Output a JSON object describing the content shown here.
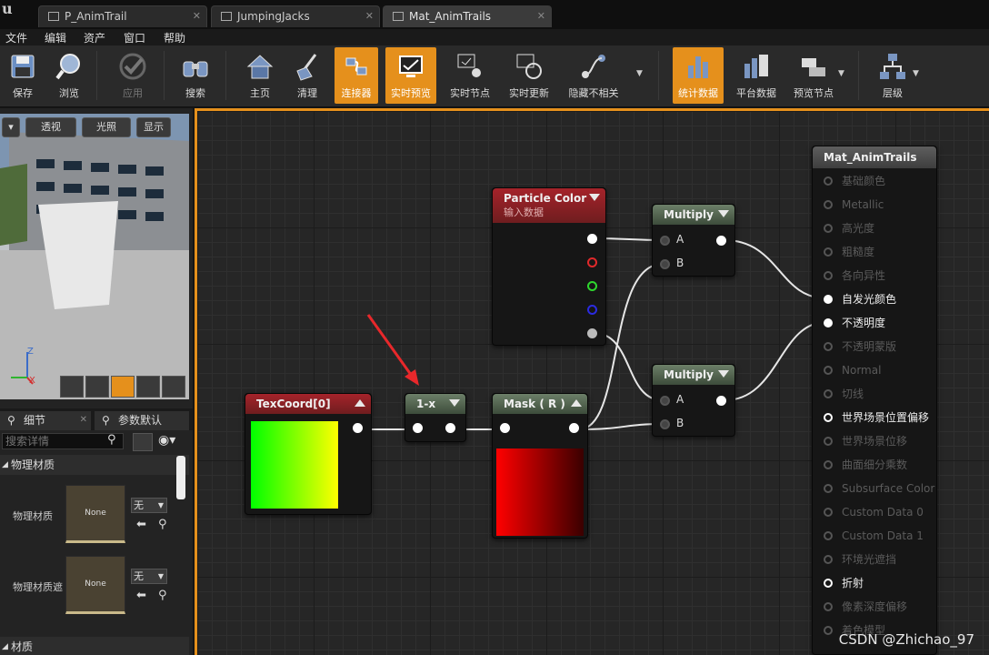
{
  "tabs": [
    {
      "label": "P_AnimTrail",
      "active": false
    },
    {
      "label": "JumpingJacks",
      "active": false
    },
    {
      "label": "Mat_AnimTrails",
      "active": true
    }
  ],
  "menu": [
    "文件",
    "编辑",
    "资产",
    "窗口",
    "帮助"
  ],
  "toolbar": {
    "save": "保存",
    "browse": "浏览",
    "apply": "应用",
    "search": "搜索",
    "home": "主页",
    "clean": "清理",
    "connector": "连接器",
    "live_preview": "实时预览",
    "live_nodes": "实时节点",
    "live_update": "实时更新",
    "hide_unrelated": "隐藏不相关",
    "stats": "统计数据",
    "platform_stats": "平台数据",
    "preview_nodes": "预览节点",
    "hierarchy": "层级"
  },
  "viewport": {
    "perspective": "透视",
    "lit": "光照",
    "show": "显示",
    "axis_z": "Z",
    "axis_x": "X"
  },
  "panel": {
    "tab_details": "细节",
    "tab_params": "参数默认",
    "search_placeholder": "搜索详情",
    "category_physical": "物理材质",
    "prop_physical": "物理材质",
    "prop_physical_mask": "物理材质遮",
    "thumb_none_1": "None",
    "thumb_none_2": "None",
    "combo_1": "无",
    "combo_2": "无",
    "category_material": "材质"
  },
  "nodes": {
    "particle_color": {
      "title": "Particle Color",
      "subtitle": "输入数据"
    },
    "texcoord": {
      "title": "TexCoord[0]"
    },
    "one_minus": {
      "title": "1-x"
    },
    "mask": {
      "title": "Mask ( R )"
    },
    "multiply_1": {
      "title": "Multiply",
      "pin_a": "A",
      "pin_b": "B"
    },
    "multiply_2": {
      "title": "Multiply",
      "pin_a": "A",
      "pin_b": "B"
    },
    "result": {
      "title": "Mat_AnimTrails",
      "rows": [
        {
          "label": "基础颜色",
          "state": "off"
        },
        {
          "label": "Metallic",
          "state": "off"
        },
        {
          "label": "高光度",
          "state": "off"
        },
        {
          "label": "粗糙度",
          "state": "off"
        },
        {
          "label": "各向异性",
          "state": "off"
        },
        {
          "label": "自发光颜色",
          "state": "on"
        },
        {
          "label": "不透明度",
          "state": "on"
        },
        {
          "label": "不透明蒙版",
          "state": "off"
        },
        {
          "label": "Normal",
          "state": "off"
        },
        {
          "label": "切线",
          "state": "off"
        },
        {
          "label": "世界场景位置偏移",
          "state": "hollowon"
        },
        {
          "label": "世界场景位移",
          "state": "off"
        },
        {
          "label": "曲面细分乘数",
          "state": "off"
        },
        {
          "label": "Subsurface Color",
          "state": "off"
        },
        {
          "label": "Custom Data 0",
          "state": "off"
        },
        {
          "label": "Custom Data 1",
          "state": "off"
        },
        {
          "label": "环境光遮挡",
          "state": "off"
        },
        {
          "label": "折射",
          "state": "hollowon"
        },
        {
          "label": "像素深度偏移",
          "state": "off"
        },
        {
          "label": "着色模型",
          "state": "off"
        }
      ]
    }
  },
  "watermark": "CSDN @Zhichao_97",
  "colors": {
    "accent": "#e5901c",
    "node_red": "#a5232a",
    "node_green": "#6c7f68"
  }
}
